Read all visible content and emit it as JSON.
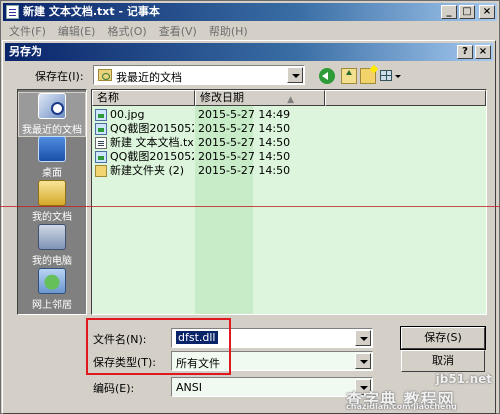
{
  "notepad": {
    "title": "新建 文本文档.txt - 记事本",
    "menu": [
      "文件(F)",
      "编辑(E)",
      "格式(O)",
      "查看(V)",
      "帮助(H)"
    ],
    "caption_buttons": {
      "minimize": "_",
      "maximize": "□",
      "close": "×"
    }
  },
  "dialog": {
    "title": "另存为",
    "caption_buttons": {
      "help": "?",
      "close": "×"
    },
    "save_in_label": "保存在(I):",
    "save_in_value": "我最近的文档",
    "places": [
      {
        "label": "我最近的文档",
        "icon": "recent-docs-icon"
      },
      {
        "label": "桌面",
        "icon": "desktop-icon"
      },
      {
        "label": "我的文档",
        "icon": "my-documents-icon"
      },
      {
        "label": "我的电脑",
        "icon": "my-computer-icon"
      },
      {
        "label": "网上邻居",
        "icon": "network-icon"
      }
    ],
    "columns": {
      "name": "名称",
      "modified": "修改日期",
      "sort_indicator": "▲"
    },
    "files": [
      {
        "name": "00.jpg",
        "date": "2015-5-27 14:49",
        "icon": "image-file-icon"
      },
      {
        "name": "QQ截图2015052...",
        "date": "2015-5-27 14:50",
        "icon": "image-file-icon"
      },
      {
        "name": "新建 文本文档.txt",
        "date": "2015-5-27 14:50",
        "icon": "text-file-icon"
      },
      {
        "name": "QQ截图2015052...",
        "date": "2015-5-27 14:50",
        "icon": "image-file-icon"
      },
      {
        "name": "新建文件夹 (2)",
        "date": "2015-5-27 14:50",
        "icon": "folder-icon"
      }
    ],
    "filename_label": "文件名(N):",
    "filename_value": "dfst.dll",
    "filetype_label": "保存类型(T):",
    "filetype_value": "所有文件",
    "encoding_label": "编码(E):",
    "encoding_value": "ANSI",
    "save_button": "保存(S)",
    "cancel_button": "取消"
  },
  "watermark": {
    "site": "jb51.net",
    "name": "查字典 教程网",
    "sub": "chazidian.com  jiaocheng"
  },
  "colors": {
    "title_bar": "#0a246a",
    "file_list_bg": "#dcf5dc",
    "annotation_box": "#e0191e"
  }
}
